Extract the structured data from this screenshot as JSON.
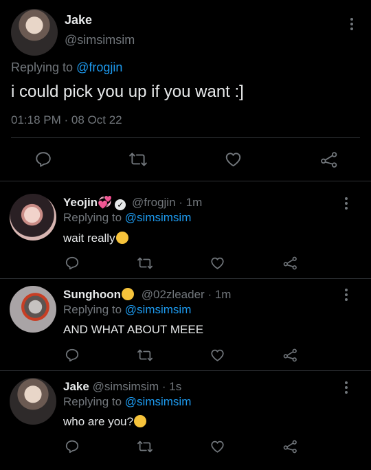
{
  "main_tweet": {
    "author_name": "Jake",
    "author_handle": "@simsimsim",
    "replying_label": "Replying to",
    "replying_handle": "@frogjin",
    "text": "i could pick you up if you want :]",
    "time": "01:18 PM",
    "date_sep": "·",
    "date": "08 Oct 22"
  },
  "replies": [
    {
      "name": "Yeojin",
      "handle": "@frogjin",
      "time": "· 1m",
      "replying_label": "Replying to",
      "replying_handle": "@simsimsim",
      "text": "wait really",
      "emoji": "flushed-face"
    },
    {
      "name": "Sunghoon",
      "handle": "@02zleader",
      "time": "· 1m",
      "replying_label": "Replying to",
      "replying_handle": "@simsimsim",
      "text": "AND WHAT ABOUT MEEE",
      "emoji": "sunglasses-face"
    },
    {
      "name": "Jake",
      "handle": "@simsimsim",
      "time": "· 1s",
      "replying_label": "Replying to",
      "replying_handle": "@simsimsim",
      "text": "who are you?",
      "emoji": "face-with-rolling-eyes"
    }
  ],
  "colors": {
    "background": "#000000",
    "text": "#e7e9ea",
    "secondary": "#71767b",
    "link": "#1d9bf0",
    "divider": "#2f3336"
  }
}
